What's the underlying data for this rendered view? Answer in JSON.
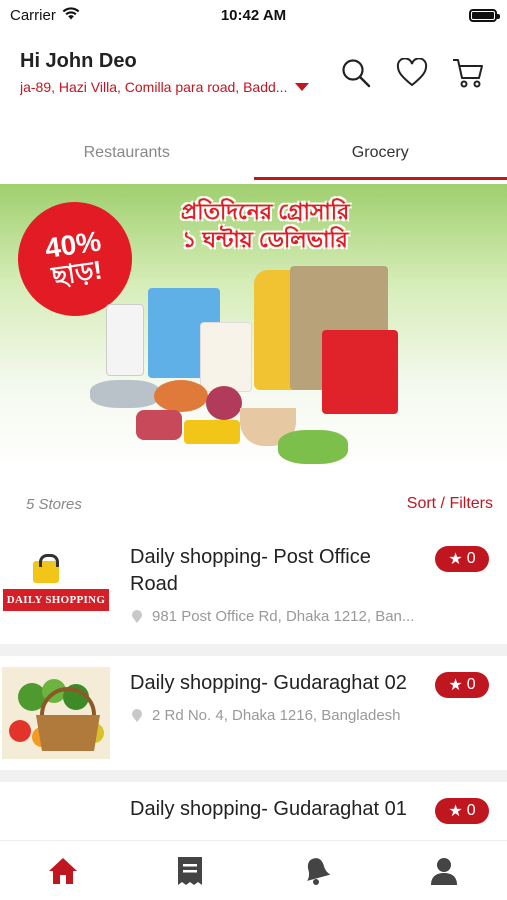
{
  "status_bar": {
    "carrier": "Carrier",
    "time": "10:42 AM"
  },
  "header": {
    "greeting": "Hi John Deo",
    "address": "ja-89, Hazi Villa, Comilla para road, Badd..."
  },
  "tabs": [
    {
      "label": "Restaurants",
      "active": false
    },
    {
      "label": "Grocery",
      "active": true
    }
  ],
  "banner": {
    "discount_top": "40%",
    "discount_bottom": "ছাড়!",
    "headline_line1": "প্রতিদিনের গ্রোসারি",
    "headline_line2": "১ ঘন্টায় ডেলিভারি"
  },
  "stores_section": {
    "count_label": "5 Stores",
    "sort_label": "Sort / Filters"
  },
  "stores": [
    {
      "name": "Daily shopping- Post Office Road",
      "address": "981 Post Office Rd, Dhaka 1212, Ban...",
      "rating": "0",
      "logo": "daily-shopping"
    },
    {
      "name": "Daily shopping- Gudaraghat 02",
      "address": "2 Rd No. 4, Dhaka 1216, Bangladesh",
      "rating": "0",
      "logo": "vegetable-basket"
    },
    {
      "name": "Daily shopping- Gudaraghat 01",
      "address": "",
      "rating": "0",
      "logo": "daily-shopping"
    }
  ],
  "logo_text": "DAILY SHOPPING",
  "colors": {
    "accent": "#c0161f",
    "badge": "#e21b24"
  },
  "bottom_nav": [
    "home-icon",
    "receipt-icon",
    "notification-icon",
    "profile-icon"
  ]
}
